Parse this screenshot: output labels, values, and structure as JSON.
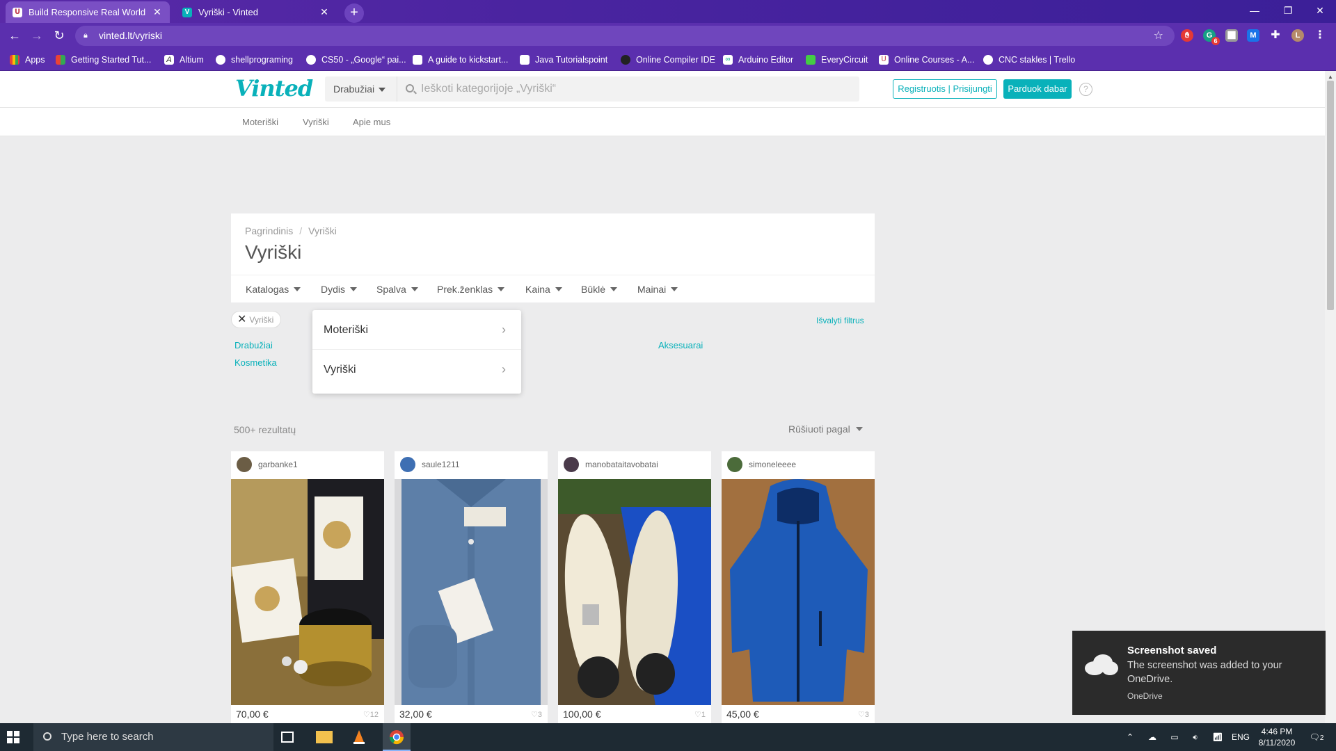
{
  "browser": {
    "tabs": [
      {
        "title": "Build Responsive Real World Web",
        "favicon_color": "#c0394b"
      },
      {
        "title": "Vyriški - Vinted",
        "favicon_color": "#09b1ba",
        "favicon_letter": "V"
      }
    ],
    "new_tab_symbol": "+",
    "url": "vinted.lt/vyriski",
    "bookmarks": [
      {
        "label": "Apps",
        "color": "#e44"
      },
      {
        "label": "Getting Started Tut...",
        "color": "#f4b400"
      },
      {
        "label": "Altium",
        "color": "#222"
      },
      {
        "label": "shellprograming",
        "color": "#fff"
      },
      {
        "label": "CS50 - „Google“ pai...",
        "color": "#fff"
      },
      {
        "label": "A guide to kickstart...",
        "color": "#fff"
      },
      {
        "label": "Java  Tutorialspoint",
        "color": "#fff"
      },
      {
        "label": "Online Compiler IDE",
        "color": "#222"
      },
      {
        "label": "Arduino Editor",
        "color": "#0a8"
      },
      {
        "label": "EveryCircuit",
        "color": "#4c4"
      },
      {
        "label": "Online Courses - A...",
        "color": "#c0394b"
      },
      {
        "label": "CNC stakles | Trello",
        "color": "#fff"
      }
    ],
    "extension_badge": "6",
    "profile_letter": "L"
  },
  "header": {
    "logo": "Vinted",
    "category_select": "Drabužiai",
    "search_placeholder": "Ieškoti kategorijoje „Vyriški“",
    "login_label": "Registruotis | Prisijungti",
    "sell_label": "Parduok dabar",
    "help_symbol": "?"
  },
  "subnav": [
    "Moteriški",
    "Vyriški",
    "Apie mus"
  ],
  "breadcrumb": [
    "Pagrindinis",
    "Vyriški"
  ],
  "breadcrumb_separator": "/",
  "page_title": "Vyriški",
  "filters": [
    "Katalogas",
    "Dydis",
    "Spalva",
    "Prek.ženklas",
    "Kaina",
    "Būklė",
    "Mainai"
  ],
  "active_chip": "Vyriški",
  "clear_filters": "Išvalyti filtrus",
  "category_links": [
    "Drabužiai",
    "Kosmetika",
    "Aksesuarai"
  ],
  "size_dropdown": {
    "options": [
      "Moteriški",
      "Vyriški"
    ]
  },
  "results_count": "500+ rezultatų",
  "sort_label": "Rūšiuoti pagal",
  "items": [
    {
      "user": "garbanke1",
      "price": "70,00 €",
      "likes": "12",
      "avatar_color": "#6b5d45"
    },
    {
      "user": "saule1211",
      "price": "32,00 €",
      "likes": "3",
      "avatar_color": "#3e6fb3"
    },
    {
      "user": "manobataitavobatai",
      "price": "100,00 €",
      "likes": "1",
      "avatar_color": "#4a3a4a"
    },
    {
      "user": "simoneleeee",
      "price": "45,00 €",
      "likes": "3",
      "avatar_color": "#4b6b3a"
    }
  ],
  "toast": {
    "title": "Screenshot saved",
    "body": "The screenshot was added to your OneDrive.",
    "source": "OneDrive"
  },
  "taskbar": {
    "search_placeholder": "Type here to search",
    "language": "ENG",
    "time": "4:46 PM",
    "date": "8/11/2020",
    "notifications": "2"
  },
  "colors": {
    "brand": "#09b1ba",
    "chrome": "#5b2fae"
  }
}
